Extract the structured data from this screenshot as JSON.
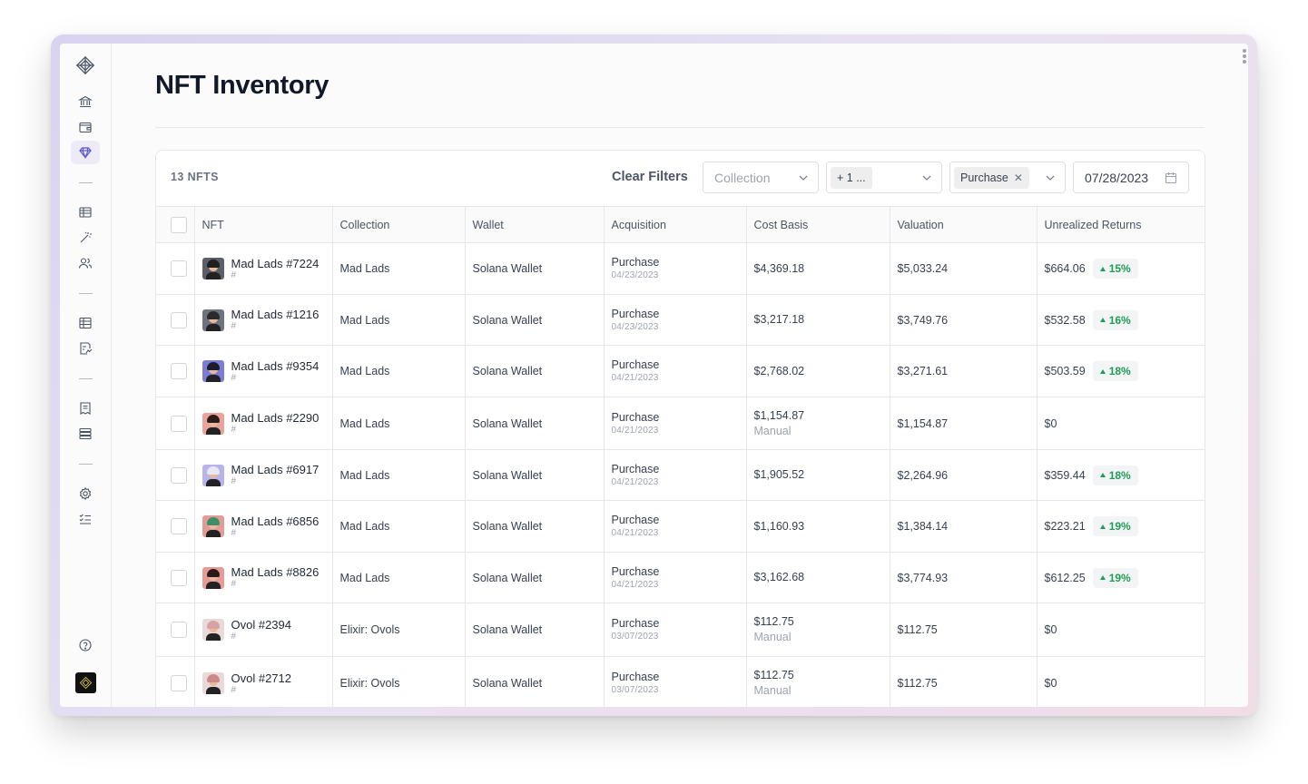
{
  "page": {
    "title": "NFT Inventory"
  },
  "colors": {
    "accent": "#5b58c9",
    "positive": "#1f9d55",
    "muted": "#9ca3af"
  },
  "sidebar": {
    "items": [
      {
        "icon": "logo-icon"
      },
      {
        "icon": "bank-icon"
      },
      {
        "icon": "wallet-icon"
      },
      {
        "icon": "diamond-icon",
        "active": true
      },
      {
        "icon": "ledger-icon"
      },
      {
        "icon": "magic-wand-icon"
      },
      {
        "icon": "users-icon"
      },
      {
        "icon": "spreadsheet-icon"
      },
      {
        "icon": "report-icon"
      },
      {
        "icon": "receipt-icon"
      },
      {
        "icon": "server-icon"
      },
      {
        "icon": "gear-icon"
      },
      {
        "icon": "checklist-icon"
      },
      {
        "icon": "help-icon"
      },
      {
        "icon": "account-avatar"
      }
    ]
  },
  "toolbar": {
    "count_label": "13 NFTS",
    "clear_filters": "Clear Filters",
    "collection_placeholder": "Collection",
    "wallet_chip": "+ 1 ...",
    "acquisition_chip": "Purchase",
    "date_value": "07/28/2023"
  },
  "table": {
    "columns": [
      "NFT",
      "Collection",
      "Wallet",
      "Acquisition",
      "Cost Basis",
      "Valuation",
      "Unrealized Returns"
    ],
    "rows": [
      {
        "name": "Mad Lads #7224",
        "sub": "#",
        "collection": "Mad Lads",
        "wallet": "Solana Wallet",
        "acq_type": "Purchase",
        "acq_date": "04/23/2023",
        "cost": "$4,369.18",
        "cost_note": "",
        "valuation": "$5,033.24",
        "returns": "$664.06",
        "pct": "15%"
      },
      {
        "name": "Mad Lads #1216",
        "sub": "#",
        "collection": "Mad Lads",
        "wallet": "Solana Wallet",
        "acq_type": "Purchase",
        "acq_date": "04/23/2023",
        "cost": "$3,217.18",
        "cost_note": "",
        "valuation": "$3,749.76",
        "returns": "$532.58",
        "pct": "16%"
      },
      {
        "name": "Mad Lads #9354",
        "sub": "#",
        "collection": "Mad Lads",
        "wallet": "Solana Wallet",
        "acq_type": "Purchase",
        "acq_date": "04/21/2023",
        "cost": "$2,768.02",
        "cost_note": "",
        "valuation": "$3,271.61",
        "returns": "$503.59",
        "pct": "18%"
      },
      {
        "name": "Mad Lads #2290",
        "sub": "#",
        "collection": "Mad Lads",
        "wallet": "Solana Wallet",
        "acq_type": "Purchase",
        "acq_date": "04/21/2023",
        "cost": "$1,154.87",
        "cost_note": "Manual",
        "valuation": "$1,154.87",
        "returns": "$0",
        "pct": ""
      },
      {
        "name": "Mad Lads #6917",
        "sub": "#",
        "collection": "Mad Lads",
        "wallet": "Solana Wallet",
        "acq_type": "Purchase",
        "acq_date": "04/21/2023",
        "cost": "$1,905.52",
        "cost_note": "",
        "valuation": "$2,264.96",
        "returns": "$359.44",
        "pct": "18%"
      },
      {
        "name": "Mad Lads #6856",
        "sub": "#",
        "collection": "Mad Lads",
        "wallet": "Solana Wallet",
        "acq_type": "Purchase",
        "acq_date": "04/21/2023",
        "cost": "$1,160.93",
        "cost_note": "",
        "valuation": "$1,384.14",
        "returns": "$223.21",
        "pct": "19%"
      },
      {
        "name": "Mad Lads #8826",
        "sub": "#",
        "collection": "Mad Lads",
        "wallet": "Solana Wallet",
        "acq_type": "Purchase",
        "acq_date": "04/21/2023",
        "cost": "$3,162.68",
        "cost_note": "",
        "valuation": "$3,774.93",
        "returns": "$612.25",
        "pct": "19%"
      },
      {
        "name": "Ovol #2394",
        "sub": "#",
        "collection": "Elixir: Ovols",
        "wallet": "Solana Wallet",
        "acq_type": "Purchase",
        "acq_date": "03/07/2023",
        "cost": "$112.75",
        "cost_note": "Manual",
        "valuation": "$112.75",
        "returns": "$0",
        "pct": ""
      },
      {
        "name": "Ovol #2712",
        "sub": "#",
        "collection": "Elixir: Ovols",
        "wallet": "Solana Wallet",
        "acq_type": "Purchase",
        "acq_date": "03/07/2023",
        "cost": "$112.75",
        "cost_note": "Manual",
        "valuation": "$112.75",
        "returns": "$0",
        "pct": ""
      }
    ]
  }
}
